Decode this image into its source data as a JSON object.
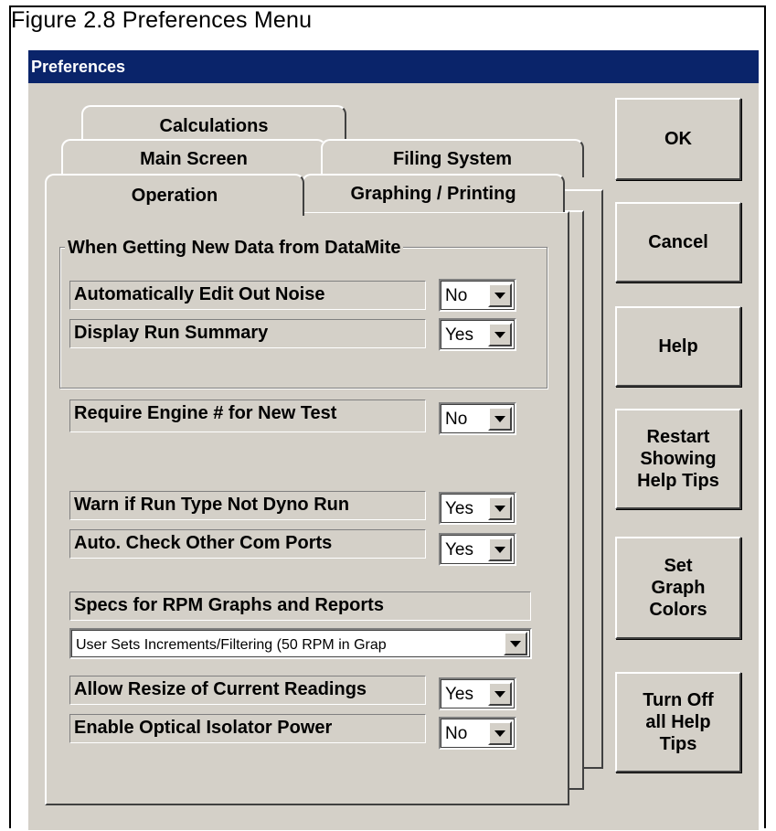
{
  "figure_caption": "Figure 2.8   Preferences Menu",
  "window": {
    "title": "Preferences"
  },
  "tabs": {
    "back_row": [
      "Calculations"
    ],
    "middle_row": [
      "Main Screen",
      "Filing System"
    ],
    "front_row": [
      "Operation",
      "Graphing / Printing"
    ],
    "active": "Operation"
  },
  "buttons": {
    "ok": "OK",
    "cancel": "Cancel",
    "help": "Help",
    "restart_help_tips": "Restart\nShowing\nHelp Tips",
    "set_graph_colors": "Set\nGraph\nColors",
    "turn_off_help_tips": "Turn Off\nall Help\nTips"
  },
  "group": {
    "title": "When Getting New Data from DataMite"
  },
  "settings": {
    "auto_edit_noise": {
      "label": "Automatically Edit Out Noise",
      "value": "No"
    },
    "display_run_summary": {
      "label": "Display Run Summary",
      "value": "Yes"
    },
    "require_engine_num": {
      "label": "Require Engine # for New Test",
      "value": "No"
    },
    "warn_run_type": {
      "label": "Warn if Run Type Not Dyno Run",
      "value": "Yes"
    },
    "auto_check_ports": {
      "label": "Auto. Check Other Com Ports",
      "value": "Yes"
    },
    "rpm_specs_header": "Specs for RPM Graphs and Reports",
    "rpm_specs": {
      "value": "User Sets Increments/Filtering (50 RPM in Grap"
    },
    "allow_resize": {
      "label": "Allow Resize of Current Readings",
      "value": "Yes"
    },
    "optical_isolator": {
      "label": "Enable Optical Isolator Power",
      "value": "No"
    }
  }
}
